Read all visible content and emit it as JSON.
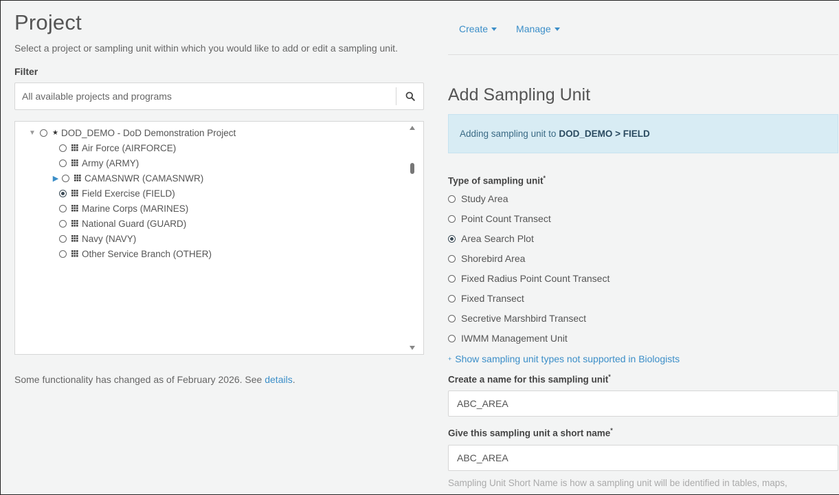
{
  "left": {
    "title": "Project",
    "intro": "Select a project or sampling unit within which you would like to add or edit a sampling unit.",
    "filter_label": "Filter",
    "search_placeholder": "All available projects and programs",
    "tree": {
      "root": {
        "label": "DOD_DEMO - DoD Demonstration Project",
        "expanded": true,
        "selected": false
      },
      "children": [
        {
          "label": "Air Force (AIRFORCE)",
          "selected": false,
          "expandable": false
        },
        {
          "label": "Army (ARMY)",
          "selected": false,
          "expandable": false
        },
        {
          "label": "CAMASNWR (CAMASNWR)",
          "selected": false,
          "expandable": true
        },
        {
          "label": "Field Exercise (FIELD)",
          "selected": true,
          "expandable": false
        },
        {
          "label": "Marine Corps (MARINES)",
          "selected": false,
          "expandable": false
        },
        {
          "label": "National Guard (GUARD)",
          "selected": false,
          "expandable": false
        },
        {
          "label": "Navy (NAVY)",
          "selected": false,
          "expandable": false
        },
        {
          "label": "Other Service Branch (OTHER)",
          "selected": false,
          "expandable": false
        }
      ]
    },
    "notice_text": "Some functionality has changed as of February 2026. See ",
    "notice_link": "details",
    "notice_end": "."
  },
  "nav": {
    "create": "Create",
    "manage": "Manage"
  },
  "form": {
    "title": "Add Sampling Unit",
    "info_prefix": "Adding sampling unit to",
    "info_target": "DOD_DEMO > FIELD",
    "type_label": "Type of sampling unit",
    "required_mark": "*",
    "types": [
      {
        "label": "Study Area",
        "selected": false
      },
      {
        "label": "Point Count Transect",
        "selected": false
      },
      {
        "label": "Area Search Plot",
        "selected": true
      },
      {
        "label": "Shorebird Area",
        "selected": false
      },
      {
        "label": "Fixed Radius Point Count Transect",
        "selected": false
      },
      {
        "label": "Fixed Transect",
        "selected": false
      },
      {
        "label": "Secretive Marshbird Transect",
        "selected": false
      },
      {
        "label": "IWMM Management Unit",
        "selected": false
      }
    ],
    "show_more_prefix": "+",
    "show_more": "Show sampling unit types not supported in Biologists",
    "name_label": "Create a name for this sampling unit",
    "name_value": "ABC_AREA",
    "short_label": "Give this sampling unit a short name",
    "short_value": "ABC_AREA",
    "help_text": "Sampling Unit Short Name is how a sampling unit will be identified in tables, maps,"
  },
  "colors": {
    "accent": "#3b8ec8",
    "info_bg": "#d8ecf4",
    "page_bg": "#f3f4f4"
  },
  "icons": {
    "search": "search-icon",
    "star": "star-icon",
    "grid": "grid-icon",
    "expand": "caret-right-icon",
    "collapse": "caret-down-icon"
  }
}
